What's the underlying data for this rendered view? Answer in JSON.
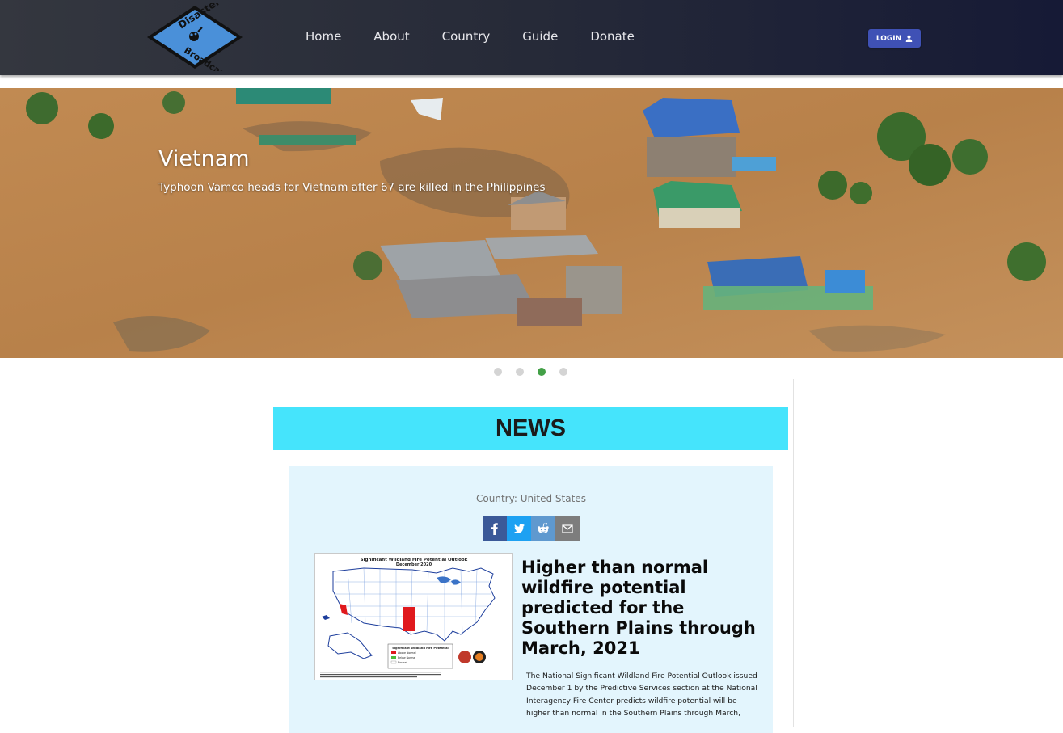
{
  "brand": {
    "logo_line1": "Disaster",
    "logo_line2": "Broadcaster",
    "logo_color": "#4a90d9"
  },
  "nav": {
    "items": [
      {
        "label": "Home"
      },
      {
        "label": "About"
      },
      {
        "label": "Country"
      },
      {
        "label": "Guide"
      },
      {
        "label": "Donate"
      }
    ],
    "login_label": "LOGIN",
    "login_icon": "person-icon"
  },
  "hero": {
    "title": "Vietnam",
    "subtitle": "Typhoon Vamco heads for Vietnam after 67 are killed in the Philippines",
    "slide_count": 4,
    "active_slide": 3
  },
  "news": {
    "header": "NEWS",
    "header_color": "#45e4fc",
    "card_color": "#e3f5fd",
    "article": {
      "country": "Country: United States",
      "share": [
        {
          "name": "facebook",
          "icon": "facebook-icon",
          "color": "#3b5998"
        },
        {
          "name": "twitter",
          "icon": "twitter-icon",
          "color": "#1da1f2"
        },
        {
          "name": "reddit",
          "icon": "reddit-icon",
          "color": "#5f99cf"
        },
        {
          "name": "email",
          "icon": "email-icon",
          "color": "#7d7d7d"
        }
      ],
      "image": {
        "title": "Significant Wildland Fire Potential Outlook",
        "subtitle": "December 2020",
        "legend_title": "Significant Wildland Fire Potential",
        "legend_items": [
          "Above Normal",
          "Below Normal",
          "Normal"
        ]
      },
      "title": "Higher than normal wildfire potential predicted for the Southern Plains through March, 2021",
      "body": "The National Significant Wildland Fire Potential Outlook issued December 1 by the Predictive Services section at the National Interagency Fire Center predicts wildfire potential will be higher than normal in the Southern Plains through March,"
    }
  }
}
